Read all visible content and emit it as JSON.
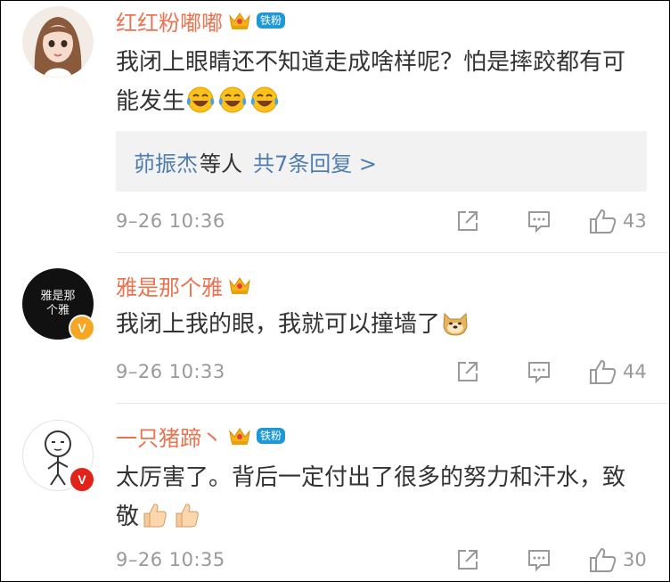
{
  "comments": [
    {
      "username": "红红粉嘟嘟",
      "fan_badge": "铁粉",
      "text": "我闭上眼睛还不知道走成啥样呢？怕是摔跤都有可能发生",
      "emoji": [
        "laughing-tears-emoji",
        "laughing-tears-emoji",
        "laughing-tears-emoji"
      ],
      "replies": {
        "names": "茆振杰",
        "suffix": "等人",
        "count": "共7条回复 >"
      },
      "time": "9–26 10:36",
      "likes": "43"
    },
    {
      "username": "雅是那个雅",
      "avatar_text": "雅是那个雅",
      "verified_badge": "V",
      "text": "我闭上我的眼，我就可以撞墙了",
      "emoji": [
        "doge-emoji"
      ],
      "time": "9–26 10:33",
      "likes": "44"
    },
    {
      "username": "一只猪蹄丶",
      "fan_badge": "铁粉",
      "verified_badge": "V",
      "text": "太厉害了。背后一定付出了很多的努力和汗水，致敬",
      "emoji": [
        "thumbs-up-emoji",
        "thumbs-up-emoji"
      ],
      "time": "9–26 10:35",
      "likes": "30"
    }
  ],
  "colors": {
    "username": "#eb7350",
    "link": "#507daf",
    "fan_badge": "#1d9ad6",
    "meta": "#999999",
    "reply_bg": "#f2f2f2",
    "verified_orange": "#f6a623",
    "verified_red": "#e2231a"
  }
}
